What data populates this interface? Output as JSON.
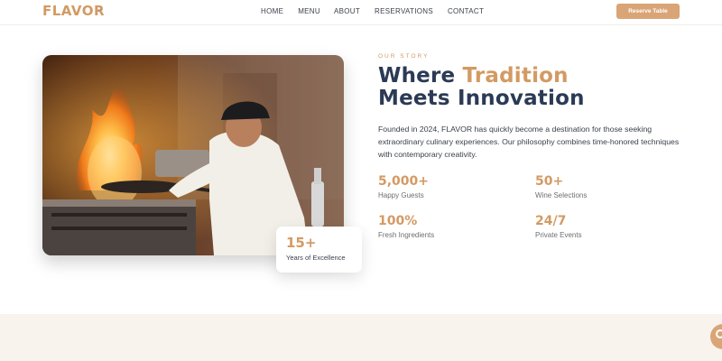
{
  "brand": {
    "logo_text": "FLAVOR",
    "logo_mark": "™"
  },
  "nav": {
    "items": [
      {
        "label": "HOME"
      },
      {
        "label": "MENU"
      },
      {
        "label": "ABOUT"
      },
      {
        "label": "RESERVATIONS"
      },
      {
        "label": "CONTACT"
      }
    ],
    "cta_label": "Reserve Table"
  },
  "about": {
    "eyebrow": "OUR STORY",
    "headline_part1": "Where ",
    "headline_accent": "Tradition",
    "headline_line2": "Meets Innovation",
    "body": "Founded in 2024, FLAVOR has quickly become a destination for those seeking extraordinary culinary experiences. Our philosophy combines time-honored techniques with contemporary creativity.",
    "badge": {
      "value": "15+",
      "label": "Years of Excellence"
    },
    "stats": [
      {
        "value": "5,000+",
        "label": "Happy Guests"
      },
      {
        "value": "50+",
        "label": "Wine Selections"
      },
      {
        "value": "100%",
        "label": "Fresh Ingredients"
      },
      {
        "value": "24/7",
        "label": "Private Events"
      }
    ],
    "image_alt": "chef flambéing a pan in a restaurant kitchen"
  },
  "colors": {
    "accent": "#d39a63",
    "navy": "#2b3a55",
    "band": "#f8f3ec"
  }
}
